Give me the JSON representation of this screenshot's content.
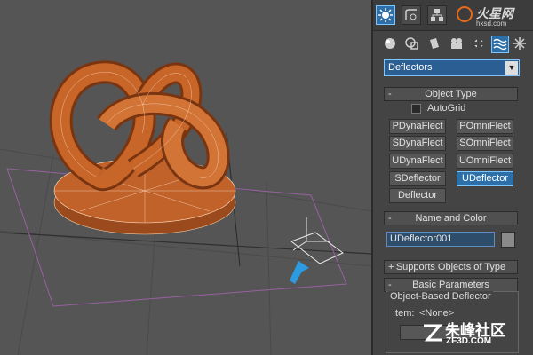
{
  "logo": {
    "brand": "火星网",
    "sub": "hxsd.com"
  },
  "tabs": [
    {
      "icon": "create-icon"
    },
    {
      "icon": "modify-icon"
    },
    {
      "icon": "hierarchy-icon"
    }
  ],
  "subtabs": [
    {
      "icon": "geometry-icon"
    },
    {
      "icon": "shapes-icon"
    },
    {
      "icon": "lights-icon"
    },
    {
      "icon": "cameras-icon"
    },
    {
      "icon": "helpers-icon"
    },
    {
      "icon": "space-warps-icon"
    },
    {
      "icon": "systems-icon"
    }
  ],
  "category_dropdown": {
    "value": "Deflectors"
  },
  "object_type": {
    "title": "Object Type",
    "sign": "-",
    "autogrid_label": "AutoGrid",
    "buttons": [
      "PDynaFlect",
      "POmniFlect",
      "SDynaFlect",
      "SOmniFlect",
      "UDynaFlect",
      "UOmniFlect",
      "SDeflector",
      "UDeflector",
      "Deflector"
    ]
  },
  "name_color": {
    "title": "Name and Color",
    "sign": "-",
    "name_value": "UDeflector001"
  },
  "supports": {
    "title": "Supports Objects of Type",
    "sign": "+"
  },
  "basic_params": {
    "title": "Basic Parameters",
    "sign": "-",
    "group_label": "Object-Based Deflector",
    "item_label": "Item:",
    "item_value": "<None>"
  },
  "watermark": {
    "cn": "朱峰社区",
    "en": "ZF3D.COM"
  },
  "colors": {
    "accent": "#2d6fa8",
    "object": "#c0622a",
    "panel": "#444444",
    "viewport": "#555555"
  }
}
